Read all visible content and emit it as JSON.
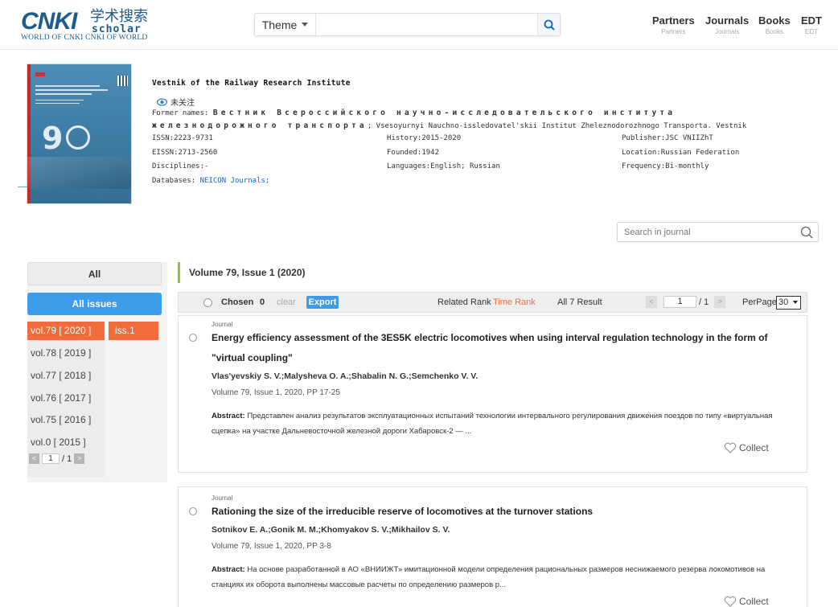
{
  "header": {
    "logo_main": "CNKI",
    "logo_cn": "学术搜索",
    "logo_scholar": "scholar",
    "logo_sub": "WORLD OF CNKI CNKI OF WORLD",
    "search": {
      "theme_label": "Theme",
      "value": "",
      "placeholder": ""
    },
    "nav": [
      {
        "label": "Partners",
        "sub": "Partners"
      },
      {
        "label": "Journals",
        "sub": "Journals"
      },
      {
        "label": "Books",
        "sub": "Books"
      },
      {
        "label": "EDT",
        "sub": "EDT"
      }
    ]
  },
  "journal": {
    "title": "Vestnik of the Railway Research Institute",
    "follow_label": "未关注",
    "former_names_label": "Former names:",
    "former_names_ru": "Вестник Всероссийского научно-исследовательского института железнодорожного транспорта",
    "former_names_rest": "; Vsesoyurnyi Nauchno-issledovatel'skii Institut Zheleznodorozhnogo Transporta. Vestnik",
    "issn": "ISSN:2223-9731",
    "eissn": "EISSN:2713-2560",
    "disciplines": "Disciplines:-",
    "databases_label": "Databases:",
    "databases_value": "NEICON Journals;",
    "history": "History:2015-2020",
    "founded": "Founded:1942",
    "languages": "Languages:English; Russian",
    "publisher": "Publisher:JSC VNIIZhT",
    "location": "Location:Russian Federation",
    "frequency": "Frequency:Bi-monthly",
    "search_placeholder": "Search in journal"
  },
  "left": {
    "all_label": "All",
    "all_issues_label": "All issues",
    "volumes": [
      "vol.79 [ 2020 ]",
      "vol.78 [ 2019 ]",
      "vol.77 [ 2018 ]",
      "vol.76 [ 2017 ]",
      "vol.75 [ 2016 ]",
      "vol.0 [ 2015 ]"
    ],
    "issue": "iss.1",
    "pager": {
      "page": "1",
      "total": "/ 1",
      "prev": "<",
      "next": ">"
    }
  },
  "content": {
    "heading": "Volume 79, Issue 1 (2020)",
    "toolbar": {
      "chosen_label": "Chosen",
      "chosen_count": "0",
      "clear_label": "clear",
      "export_label": "Export",
      "related_rank": "Related Rank",
      "time_rank": "Time Rank",
      "result_label": "All 7 Result",
      "page": "1",
      "total": "/ 1",
      "perpage_label": "PerPage",
      "perpage_value": "30",
      "prev": "<",
      "next": ">"
    },
    "articles": [
      {
        "type": "Journal",
        "title": "Energy efficiency assessment of the 3ES5K electric locomotives when using interval regulation technology in the form of \"virtual coupling\"",
        "authors": "Vlas'yevskiy S. V.;Malysheva O. A.;Shabalin N. G.;Semchenko V. V.",
        "source": "Volume 79, Issue 1, 2020, PP 17-25",
        "abstract_label": "Abstract:",
        "abstract": "Представлен анализ результатов эксплуатационных испытаний технологии интервального регулирования движения поездов по типу «виртуальная сцепка» на участке Дальневосточной железной дороги Хабаровск-2 — ...",
        "collect": "Collect"
      },
      {
        "type": "Journal",
        "title": "Rationing the size of the irreducible reserve of locomotives at the turnover stations",
        "authors": "Sotnikov E. A.;Gonik M. M.;Khomyakov S. V.;Mikhailov S. V.",
        "source": "Volume 79, Issue 1, 2020, PP 3-8",
        "abstract_label": "Abstract:",
        "abstract": "На основе разработанной в АО «ВНИИЖТ» имитационной модели определения рациональных размеров неснижаемого резерва локомотивов на станциях их оборота выполнены массовые расчеты по определению размеров р...",
        "collect": "Collect"
      }
    ]
  },
  "colors": {
    "brand": "#1b5b8e",
    "accent_blue": "#3d9be9",
    "active_orange": "#f26b3a",
    "time_rank": "#f26b3a",
    "heading_bar": "#8cc63f"
  },
  "icons": {
    "search": "magnifier-icon",
    "eye": "eye-icon",
    "heart": "heart-icon"
  }
}
